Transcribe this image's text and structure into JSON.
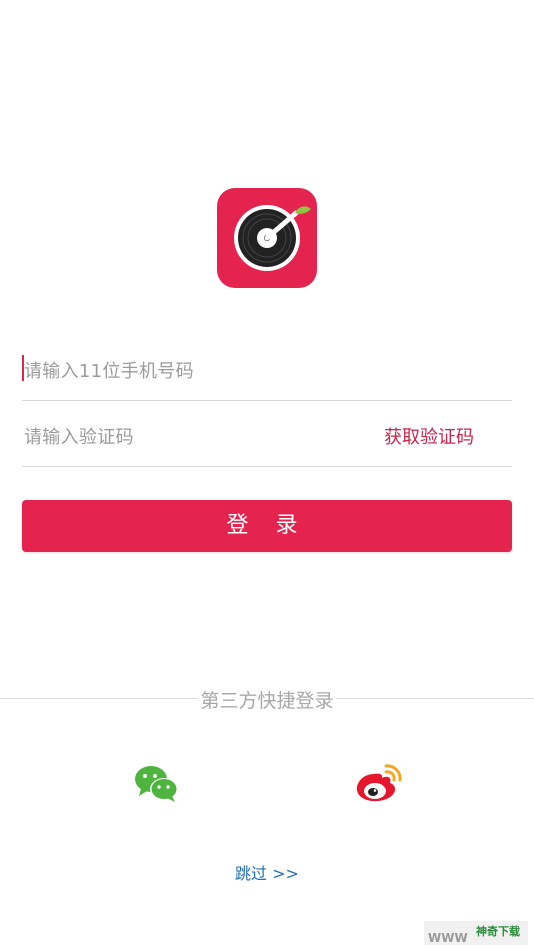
{
  "app": {
    "logo": "vinyl-record-leaf-logo",
    "brand_color": "#e5234f"
  },
  "login_form": {
    "phone_placeholder": "请输入11位手机号码",
    "code_placeholder": "请输入验证码",
    "get_code_label": "获取验证码",
    "submit_label": "登 录"
  },
  "third_party": {
    "title": "第三方快捷登录",
    "providers": [
      {
        "name": "wechat-icon",
        "color": "#4fb33f"
      },
      {
        "name": "weibo-icon",
        "color": "#e6162d"
      }
    ]
  },
  "skip": {
    "label": "跳过 >>"
  },
  "watermark": {
    "brand": "神奇下载",
    "url": "WWW"
  }
}
